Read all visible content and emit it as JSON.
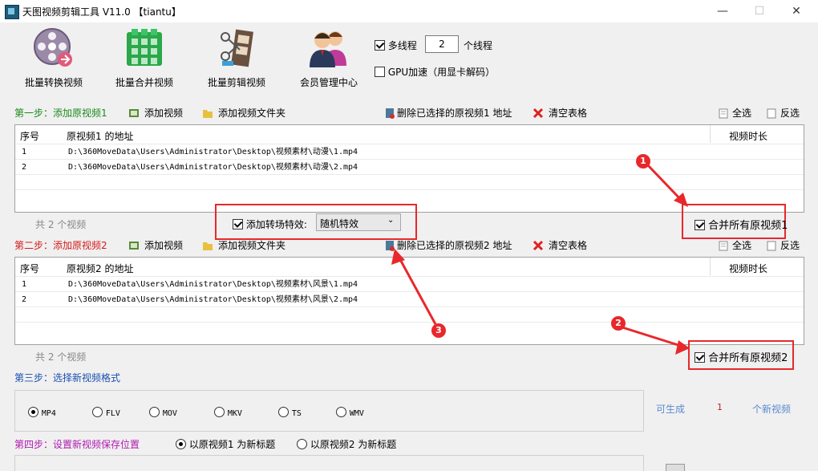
{
  "window": {
    "title": "天图视频剪辑工具 V11.0  【tiantu】",
    "minimize": "—",
    "maximize": "☐",
    "close": "✕"
  },
  "toolbar": {
    "batch_convert": "批量转换视频",
    "batch_merge": "批量合并视频",
    "batch_cut": "批量剪辑视频",
    "member": "会员管理中心",
    "multithread_label": "多线程",
    "thread_count": "2",
    "thread_unit": "个线程",
    "gpu_label": "GPU加速（用显卡解码）"
  },
  "step1": {
    "title": "第一步：添加原视频1",
    "add_video": "添加视频",
    "add_folder": "添加视频文件夹",
    "delete_selected": "删除已选择的原视频1 地址",
    "clear": "清空表格",
    "select_all": "全选",
    "invert": "反选",
    "col_index": "序号",
    "col_path": "原视频1 的地址",
    "col_duration": "视频时长",
    "rows": [
      {
        "index": "1",
        "path": "D:\\360MoveData\\Users\\Administrator\\Desktop\\视频素材\\动漫\\1.mp4"
      },
      {
        "index": "2",
        "path": "D:\\360MoveData\\Users\\Administrator\\Desktop\\视频素材\\动漫\\2.mp4"
      }
    ],
    "count_text": "共 2 个视频",
    "merge_all": "合并所有原视频1"
  },
  "transition": {
    "label": "添加转场特效:",
    "value": "随机特效"
  },
  "step2": {
    "title": "第二步：添加原视频2",
    "add_video": "添加视频",
    "add_folder": "添加视频文件夹",
    "delete_selected": "删除已选择的原视频2 地址",
    "clear": "清空表格",
    "select_all": "全选",
    "invert": "反选",
    "col_index": "序号",
    "col_path": "原视频2 的地址",
    "col_duration": "视频时长",
    "rows": [
      {
        "index": "1",
        "path": "D:\\360MoveData\\Users\\Administrator\\Desktop\\视频素材\\风景\\1.mp4"
      },
      {
        "index": "2",
        "path": "D:\\360MoveData\\Users\\Administrator\\Desktop\\视频素材\\风景\\2.mp4"
      }
    ],
    "count_text": "共 2 个视频",
    "merge_all": "合并所有原视频2"
  },
  "step3": {
    "title": "第三步：选择新视频格式",
    "formats": [
      "MP4",
      "FLV",
      "MOV",
      "MKV",
      "TS",
      "WMV"
    ],
    "selected": "MP4",
    "can_generate": "可生成",
    "generate_count": "1",
    "new_videos": "个新视频"
  },
  "step4": {
    "title": "第四步：设置新视频保存位置",
    "opt1": "以原视频1 为新标题",
    "opt2": "以原视频2 为新标题"
  },
  "callouts": {
    "c1": "1",
    "c2": "2",
    "c3": "3"
  },
  "colors": {
    "highlight": "#e8282c",
    "step_green": "#1a8a1a",
    "step_red": "#d41a1a",
    "step_purple": "#b01ab0"
  }
}
